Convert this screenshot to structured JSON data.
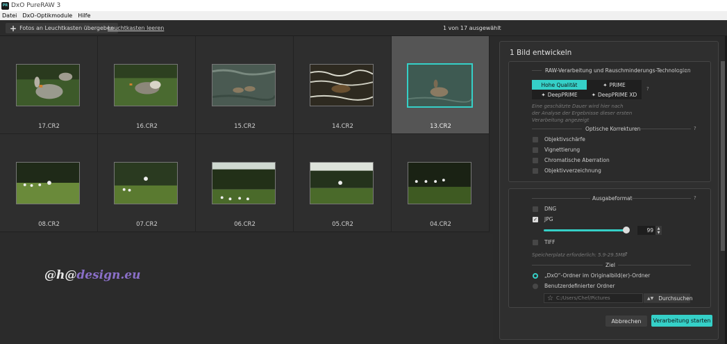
{
  "window": {
    "title": "DxO PureRAW 3",
    "app_icon_text": "PR"
  },
  "menu": [
    "Datei",
    "DxO-Optikmodule",
    "Hilfe"
  ],
  "toolbar": {
    "add_label": "Fotos an Leuchtkasten übergeben",
    "clear_label": "Leuchtkasten leeren",
    "selection_count": "1 von 17 ausgewählt"
  },
  "thumbnails": [
    {
      "label": "17.CR2",
      "selected": false
    },
    {
      "label": "16.CR2",
      "selected": false
    },
    {
      "label": "15.CR2",
      "selected": false
    },
    {
      "label": "14.CR2",
      "selected": false
    },
    {
      "label": "13.CR2",
      "selected": true
    },
    {
      "label": "08.CR2",
      "selected": false
    },
    {
      "label": "07.CR2",
      "selected": false
    },
    {
      "label": "06.CR2",
      "selected": false
    },
    {
      "label": "05.CR2",
      "selected": false
    },
    {
      "label": "04.CR2",
      "selected": false
    }
  ],
  "watermark": {
    "part1": "@h@",
    "part2": "design.eu"
  },
  "panel": {
    "title": "1 Bild entwickeln",
    "raw_section": {
      "heading": "RAW-Verarbeitung und Rauschminderungs-Technologien",
      "options": [
        "Hohe Qualität",
        "PRIME",
        "DeepPRIME",
        "DeepPRIME XD"
      ],
      "active": "Hohe Qualität",
      "help": "?",
      "hint": "Eine geschätzte Dauer wird hier nach der Analyse der Ergebnisse dieser ersten Verarbeitung angezeigt"
    },
    "optical_section": {
      "heading": "Optische Korrekturen",
      "help": "?",
      "items": [
        "Objektivschärfe",
        "Vignettierung",
        "Chromatische Aberration",
        "Objektivverzeichnung"
      ]
    },
    "output_section": {
      "heading": "Ausgabeformat",
      "help": "?",
      "dng": "DNG",
      "jpg": "JPG",
      "jpg_quality": "99",
      "tiff": "TIFF",
      "space_text": "Speicherplatz erforderlich: 5.9-29.5MB",
      "space_help": "?"
    },
    "target_section": {
      "heading": "Ziel",
      "option1": "„DxO“-Ordner im Originalbild(er)-Ordner",
      "option2": "Benutzerdefinierter Ordner",
      "path": "C:/Users/Chef/Pictures",
      "browse": "Durchsuchen"
    },
    "cancel": "Abbrechen",
    "start": "Verarbeitung starten"
  },
  "colors": {
    "accent": "#35d0c8",
    "background": "#2a2a2a"
  }
}
